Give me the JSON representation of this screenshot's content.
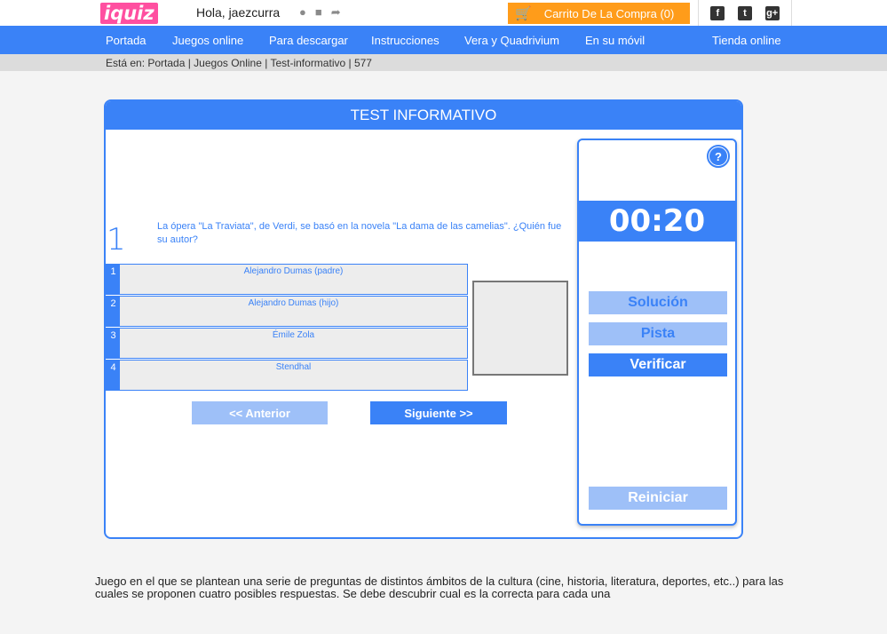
{
  "header": {
    "logo": "iquiz",
    "greeting": "Hola, jaezcurra",
    "icons": [
      "user-icon",
      "lock-icon",
      "share-icon"
    ],
    "cart_label": "Carrito De La Compra (0)",
    "social": [
      "f",
      "t",
      "g+"
    ]
  },
  "nav": {
    "items": [
      "Portada",
      "Juegos online",
      "Para descargar",
      "Instrucciones",
      "Vera y Quadrivium",
      "En su móvil",
      "Tienda online"
    ]
  },
  "breadcrumb": "Está en: Portada | Juegos Online | Test-informativo | 577",
  "game": {
    "title": "TEST INFORMATIVO",
    "question_number": "1",
    "question": "La ópera \"La Traviata\", de Verdi, se basó en la novela \"La dama de las camelias\". ¿Quién fue su autor?",
    "answers": [
      {
        "num": "1",
        "text": "Alejandro Dumas (padre)"
      },
      {
        "num": "2",
        "text": "Alejandro Dumas (hijo)"
      },
      {
        "num": "3",
        "text": "Émile Zola"
      },
      {
        "num": "4",
        "text": "Stendhal"
      }
    ],
    "prev_label": "<< Anterior",
    "next_label": "Siguiente >>",
    "help_label": "?",
    "timer": "00:20",
    "solution_label": "Solución",
    "hint_label": "Pista",
    "verify_label": "Verificar",
    "restart_label": "Reiniciar"
  },
  "description": "Juego en el que se plantean una serie de preguntas de distintos ámbitos de la cultura (cine, historia, literatura, deportes, etc..) para las cuales se proponen cuatro posibles respuestas. Se debe descubrir cual es la correcta para cada una",
  "colors": {
    "primary": "#3a82f7",
    "light": "#9ec0f8",
    "cart": "#ff9c1a",
    "logo_accent": "#ff4fa0"
  }
}
